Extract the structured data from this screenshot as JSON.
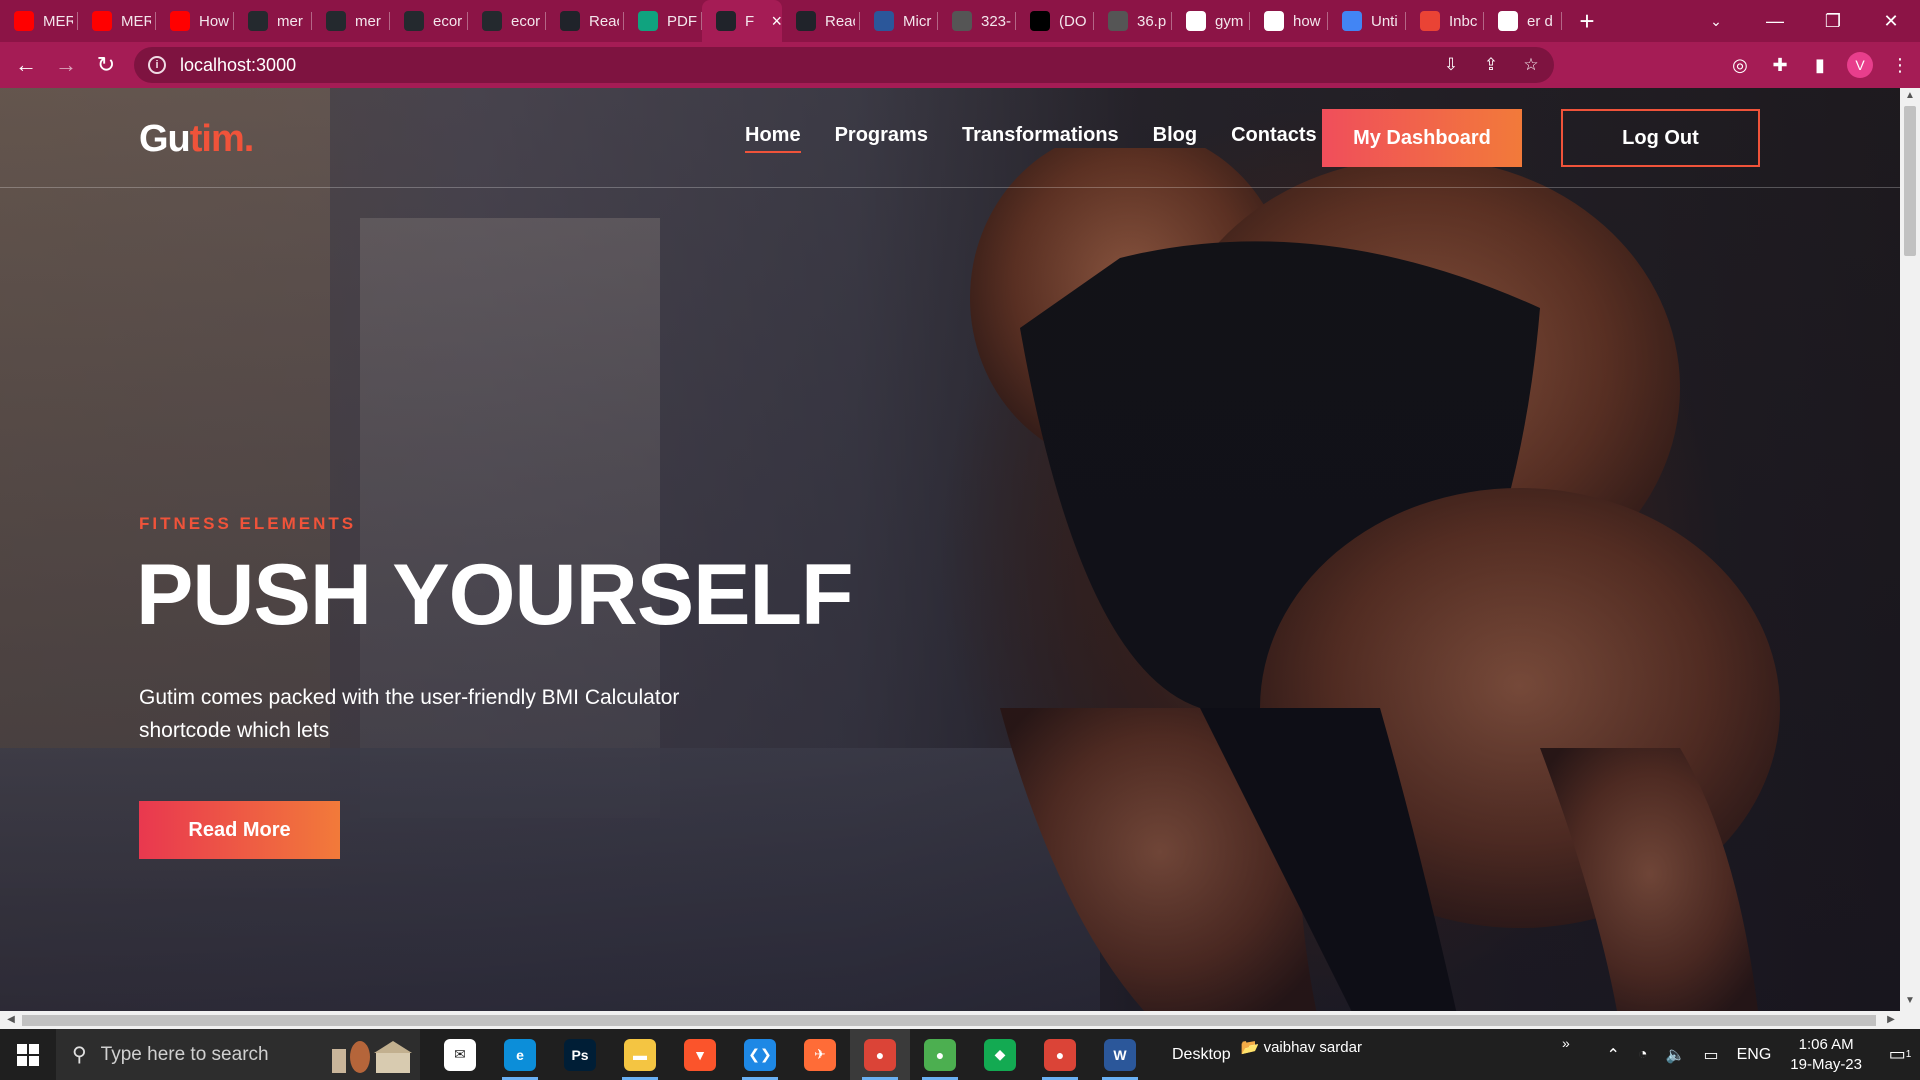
{
  "browser": {
    "tabs": [
      {
        "label": "MER",
        "icon": "youtube-icon",
        "color": "#ff0000"
      },
      {
        "label": "MER",
        "icon": "youtube-icon",
        "color": "#ff0000"
      },
      {
        "label": "How",
        "icon": "youtube-icon",
        "color": "#ff0000"
      },
      {
        "label": "mer",
        "icon": "github-icon",
        "color": "#24292e"
      },
      {
        "label": "mer",
        "icon": "github-icon",
        "color": "#24292e"
      },
      {
        "label": "ecor",
        "icon": "github-icon",
        "color": "#24292e"
      },
      {
        "label": "ecor",
        "icon": "github-icon",
        "color": "#24292e"
      },
      {
        "label": "Reac",
        "icon": "react-icon",
        "color": "#20232a"
      },
      {
        "label": "PDF",
        "icon": "chatgpt-icon",
        "color": "#10a37f"
      },
      {
        "label": "F",
        "icon": "react-icon",
        "color": "#20232a",
        "active": true
      },
      {
        "label": "Reac",
        "icon": "react-icon",
        "color": "#20232a"
      },
      {
        "label": "Micr",
        "icon": "document-icon",
        "color": "#2b579a"
      },
      {
        "label": "323-",
        "icon": "globe-icon",
        "color": "#555555"
      },
      {
        "label": "(DO",
        "icon": "letter-a-icon",
        "color": "#000000"
      },
      {
        "label": "36.p",
        "icon": "globe-icon",
        "color": "#555555"
      },
      {
        "label": "gym",
        "icon": "google-icon",
        "color": "#ffffff"
      },
      {
        "label": "how",
        "icon": "google-icon",
        "color": "#ffffff"
      },
      {
        "label": "Unti",
        "icon": "google-docs-icon",
        "color": "#4285f4"
      },
      {
        "label": "Inbc",
        "icon": "gmail-icon",
        "color": "#ea4335"
      },
      {
        "label": "er d",
        "icon": "google-icon",
        "color": "#ffffff"
      }
    ],
    "new_tab": "+",
    "url": "localhost:3000",
    "profile_initial": "V",
    "theme_color": "#a51c55"
  },
  "site": {
    "logo_main": "Gu",
    "logo_accent": "tim.",
    "accent_color": "#f0533a",
    "nav": [
      {
        "label": "Home",
        "active": true
      },
      {
        "label": "Programs"
      },
      {
        "label": "Transformations"
      },
      {
        "label": "Blog"
      },
      {
        "label": "Contacts"
      }
    ],
    "dashboard_button": "My Dashboard",
    "logout_button": "Log Out",
    "hero": {
      "eyebrow": "FITNESS ELEMENTS",
      "title": "PUSH YOURSELF",
      "text": "Gutim comes packed with the user-friendly BMI Calculator shortcode which lets",
      "button": "Read More"
    }
  },
  "taskbar": {
    "search_placeholder": "Type here to search",
    "desktop_label": "Desktop",
    "user_label": "vaibhav sardar",
    "overflow": "»",
    "language": "ENG",
    "time": "1:06 AM",
    "date": "19-May-23",
    "notification_count": "1",
    "apps": [
      {
        "name": "mail-icon",
        "color": "#ffffff",
        "glyph": "✉"
      },
      {
        "name": "edge-icon",
        "color": "#0c8ed9",
        "glyph": "e"
      },
      {
        "name": "photoshop-icon",
        "color": "#001e36",
        "glyph": "Ps"
      },
      {
        "name": "file-explorer-icon",
        "color": "#f4c542",
        "glyph": "▬"
      },
      {
        "name": "brave-icon",
        "color": "#fb542b",
        "glyph": "▼"
      },
      {
        "name": "vscode-icon",
        "color": "#1e88e5",
        "glyph": "❮❯"
      },
      {
        "name": "postman-icon",
        "color": "#ff6c37",
        "glyph": "✈"
      },
      {
        "name": "chrome-profile-icon",
        "color": "#db4437",
        "glyph": "●",
        "active": true
      },
      {
        "name": "chrome-icon",
        "color": "#4caf50",
        "glyph": "●"
      },
      {
        "name": "mongodb-compass-icon",
        "color": "#13aa52",
        "glyph": "◆"
      },
      {
        "name": "chrome-alt-icon",
        "color": "#db4437",
        "glyph": "●"
      },
      {
        "name": "word-icon",
        "color": "#2b579a",
        "glyph": "W"
      }
    ]
  }
}
